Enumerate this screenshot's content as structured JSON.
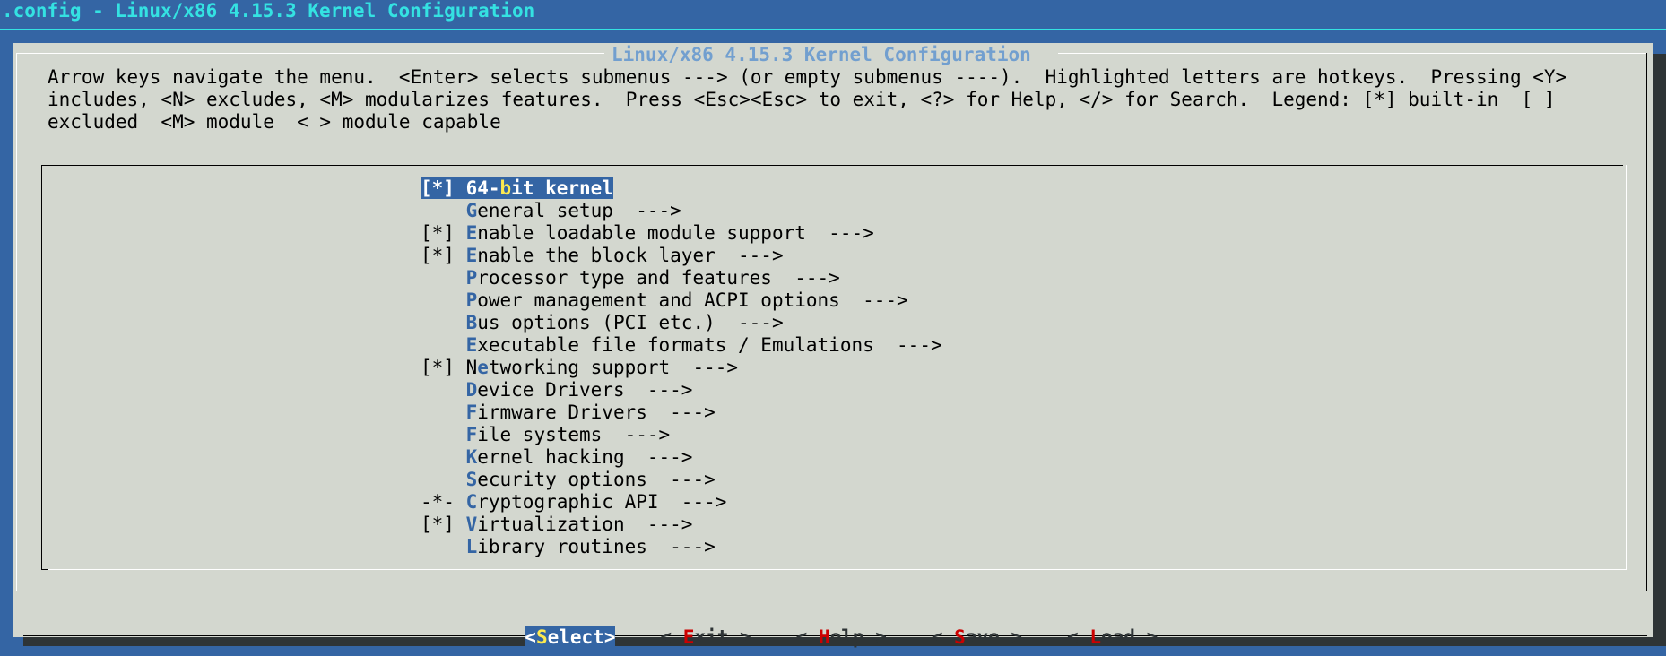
{
  "window": {
    "title": ".config - Linux/x86 4.15.3 Kernel Configuration"
  },
  "dialog": {
    "title": "Linux/x86 4.15.3 Kernel Configuration",
    "help_lines": [
      "Arrow keys navigate the menu.  <Enter> selects submenus ---> (or empty submenus ----).  Highlighted letters are hotkeys.  Pressing <Y>",
      "includes, <N> excludes, <M> modularizes features.  Press <Esc><Esc> to exit, <?> for Help, </> for Search.  Legend: [*] built-in  [ ]",
      "excluded  <M> module  < > module capable"
    ]
  },
  "menu": {
    "items": [
      {
        "prefix": "[*] ",
        "pre": "64-",
        "hot": "b",
        "post": "it kernel",
        "selected": true
      },
      {
        "prefix": "    ",
        "pre": "",
        "hot": "G",
        "post": "eneral setup  --->",
        "selected": false
      },
      {
        "prefix": "[*] ",
        "pre": "",
        "hot": "E",
        "post": "nable loadable module support  --->",
        "selected": false
      },
      {
        "prefix": "[*] ",
        "pre": "",
        "hot": "E",
        "post": "nable the block layer  --->",
        "selected": false
      },
      {
        "prefix": "    ",
        "pre": "",
        "hot": "P",
        "post": "rocessor type and features  --->",
        "selected": false
      },
      {
        "prefix": "    ",
        "pre": "",
        "hot": "P",
        "post": "ower management and ACPI options  --->",
        "selected": false
      },
      {
        "prefix": "    ",
        "pre": "",
        "hot": "B",
        "post": "us options (PCI etc.)  --->",
        "selected": false
      },
      {
        "prefix": "    ",
        "pre": "",
        "hot": "E",
        "post": "xecutable file formats / Emulations  --->",
        "selected": false
      },
      {
        "prefix": "[*] ",
        "pre": "N",
        "hot": "e",
        "post": "tworking support  --->",
        "selected": false
      },
      {
        "prefix": "    ",
        "pre": "",
        "hot": "D",
        "post": "evice Drivers  --->",
        "selected": false
      },
      {
        "prefix": "    ",
        "pre": "",
        "hot": "F",
        "post": "irmware Drivers  --->",
        "selected": false
      },
      {
        "prefix": "    ",
        "pre": "",
        "hot": "F",
        "post": "ile systems  --->",
        "selected": false
      },
      {
        "prefix": "    ",
        "pre": "",
        "hot": "K",
        "post": "ernel hacking  --->",
        "selected": false
      },
      {
        "prefix": "    ",
        "pre": "",
        "hot": "S",
        "post": "ecurity options  --->",
        "selected": false
      },
      {
        "prefix": "-*- ",
        "pre": "",
        "hot": "C",
        "post": "ryptographic API  --->",
        "selected": false
      },
      {
        "prefix": "[*] ",
        "pre": "",
        "hot": "V",
        "post": "irtualization  --->",
        "selected": false
      },
      {
        "prefix": "    ",
        "pre": "",
        "hot": "L",
        "post": "ibrary routines  --->",
        "selected": false
      }
    ]
  },
  "buttons": [
    {
      "open": "<",
      "hot": "S",
      "rest": "elect",
      "close": ">",
      "selected": true
    },
    {
      "open": "< ",
      "hot": "E",
      "rest": "xit",
      "close": " >",
      "selected": false
    },
    {
      "open": "< ",
      "hot": "H",
      "rest": "elp",
      "close": " >",
      "selected": false
    },
    {
      "open": "< ",
      "hot": "S",
      "rest": "ave",
      "close": " >",
      "selected": false
    },
    {
      "open": "< ",
      "hot": "L",
      "rest": "oad",
      "close": " >",
      "selected": false
    }
  ],
  "colors": {
    "background": "#3465a4",
    "dialog": "#d3d7cf",
    "title_text": "#34e2e2",
    "hotkey": "#3465a4",
    "button_hotkey": "#cc0000",
    "highlight": "#3465a4",
    "highlight_hotkey": "#fce94f"
  }
}
